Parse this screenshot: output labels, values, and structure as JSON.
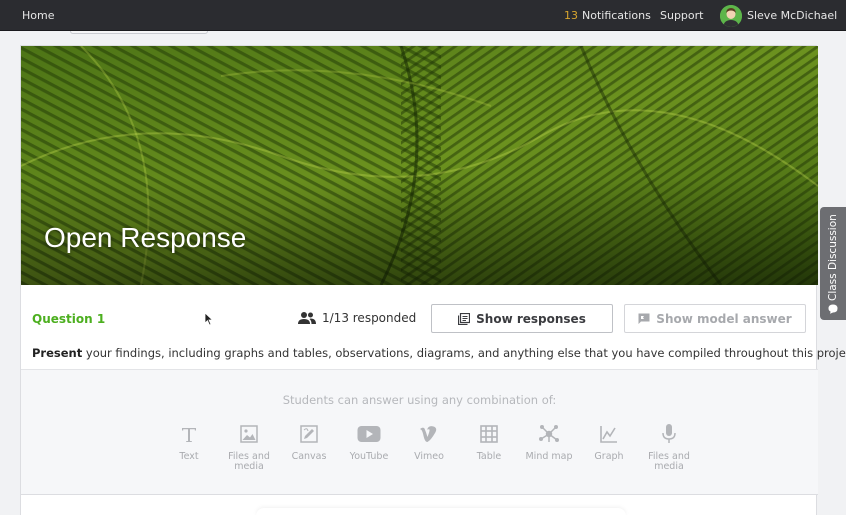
{
  "nav": {
    "home": "Home",
    "notifications_count": "13",
    "notifications_label": "Notifications",
    "support": "Support",
    "user_name": "Sleve McDichael"
  },
  "banner": {
    "title": "Open Response"
  },
  "question": {
    "label": "Question 1",
    "responded": "1/13 responded",
    "show_responses": "Show responses",
    "show_model_answer": "Show model answer",
    "prompt_bold": "Present",
    "prompt_rest": " your findings, including graphs and tables, observations, diagrams, and anything else that you have compiled throughout this project."
  },
  "answer_types": {
    "hint": "Students can answer using any combination of:",
    "items": [
      {
        "label": "Text",
        "icon": "text-icon"
      },
      {
        "label": "Files and media",
        "icon": "image-icon"
      },
      {
        "label": "Canvas",
        "icon": "canvas-icon"
      },
      {
        "label": "YouTube",
        "icon": "youtube-icon"
      },
      {
        "label": "Vimeo",
        "icon": "vimeo-icon"
      },
      {
        "label": "Table",
        "icon": "table-icon"
      },
      {
        "label": "Mind map",
        "icon": "mind-map-icon"
      },
      {
        "label": "Graph",
        "icon": "graph-icon"
      },
      {
        "label": "Files and media",
        "icon": "microphone-icon"
      }
    ]
  },
  "side_tab": {
    "label": "Class Discussion"
  },
  "colors": {
    "accent_green": "#4caf1f",
    "notif_count": "#d9a62e",
    "topbar": "#2b2c30"
  }
}
